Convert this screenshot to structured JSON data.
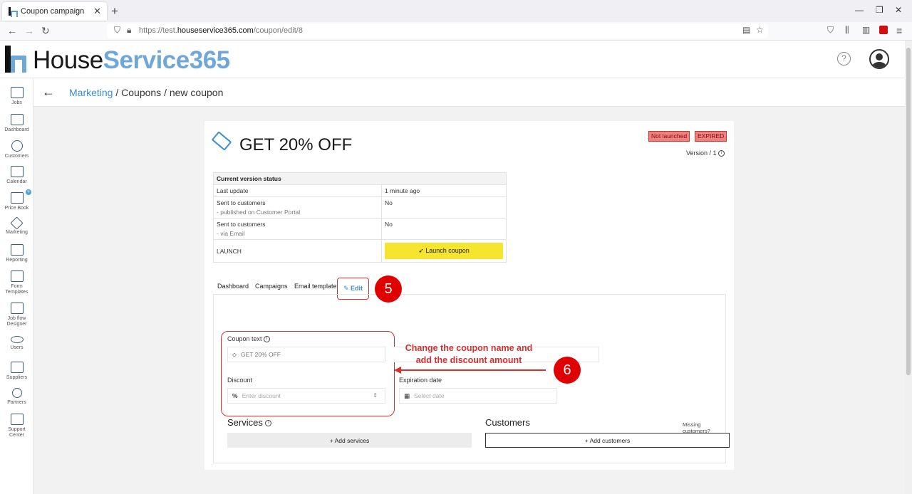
{
  "browser": {
    "tab_title": "Coupon campaign",
    "tab_close": "✕",
    "new_tab": "+",
    "url_prefix": "https://test.",
    "url_domain": "houseservice365.com",
    "url_path": "/coupon/edit/8"
  },
  "app": {
    "logo_part1": "House",
    "logo_part2": "Service365",
    "help": "?"
  },
  "sidebar": {
    "items": [
      {
        "label": "Jobs"
      },
      {
        "label": "Dashboard"
      },
      {
        "label": "Customers"
      },
      {
        "label": "Calendar"
      },
      {
        "label": "Price Book"
      },
      {
        "label": "Marketing"
      },
      {
        "label": "Reporting"
      },
      {
        "label": "Form Templates"
      },
      {
        "label": "Job flow Designer"
      },
      {
        "label": "Users"
      },
      {
        "label": "Suppliers"
      },
      {
        "label": "Partners"
      },
      {
        "label": "Support Center"
      }
    ]
  },
  "breadcrumb": {
    "link": "Marketing",
    "rest": " / Coupons / new coupon"
  },
  "coupon": {
    "title": "GET 20% OFF",
    "badge_not_launched": "Not launched",
    "badge_expired": "EXPIRED",
    "version": "Version / 1",
    "status_table": {
      "header": "Current version status",
      "rows": [
        {
          "label": "Last update",
          "value": "1 minute ago"
        },
        {
          "label": "Sent to customers",
          "sub": "- published on Customer Portal",
          "value": "No"
        },
        {
          "label": "Sent to customers",
          "sub": "- via Email",
          "value": "No"
        },
        {
          "label": "LAUNCH"
        }
      ],
      "launch_label": "Launch coupon"
    },
    "tabs": {
      "dashboard": "Dashboard",
      "campaigns": "Campaigns",
      "email_template": "Email template",
      "edit": "Edit"
    },
    "form": {
      "coupon_text_label": "Coupon text",
      "coupon_text_value": "GET 20% OFF",
      "discount_label": "Discount",
      "discount_prefix": "%",
      "discount_placeholder": "Enter discount",
      "expiration_label": "Expiration date",
      "expiration_placeholder": "Select date"
    },
    "services_title": "Services",
    "add_services": "+ Add services",
    "customers_title": "Customers",
    "missing_customers": "Missing customers?",
    "add_customers": "+ Add customers"
  },
  "annotations": {
    "step5": "5",
    "step6": "6",
    "note_line1": "Change the coupon name and",
    "note_line2": "add the discount amount"
  },
  "colors": {
    "accent": "#3c8fcf",
    "launch_button": "#f5e52e",
    "annotation_red": "#e00000"
  }
}
